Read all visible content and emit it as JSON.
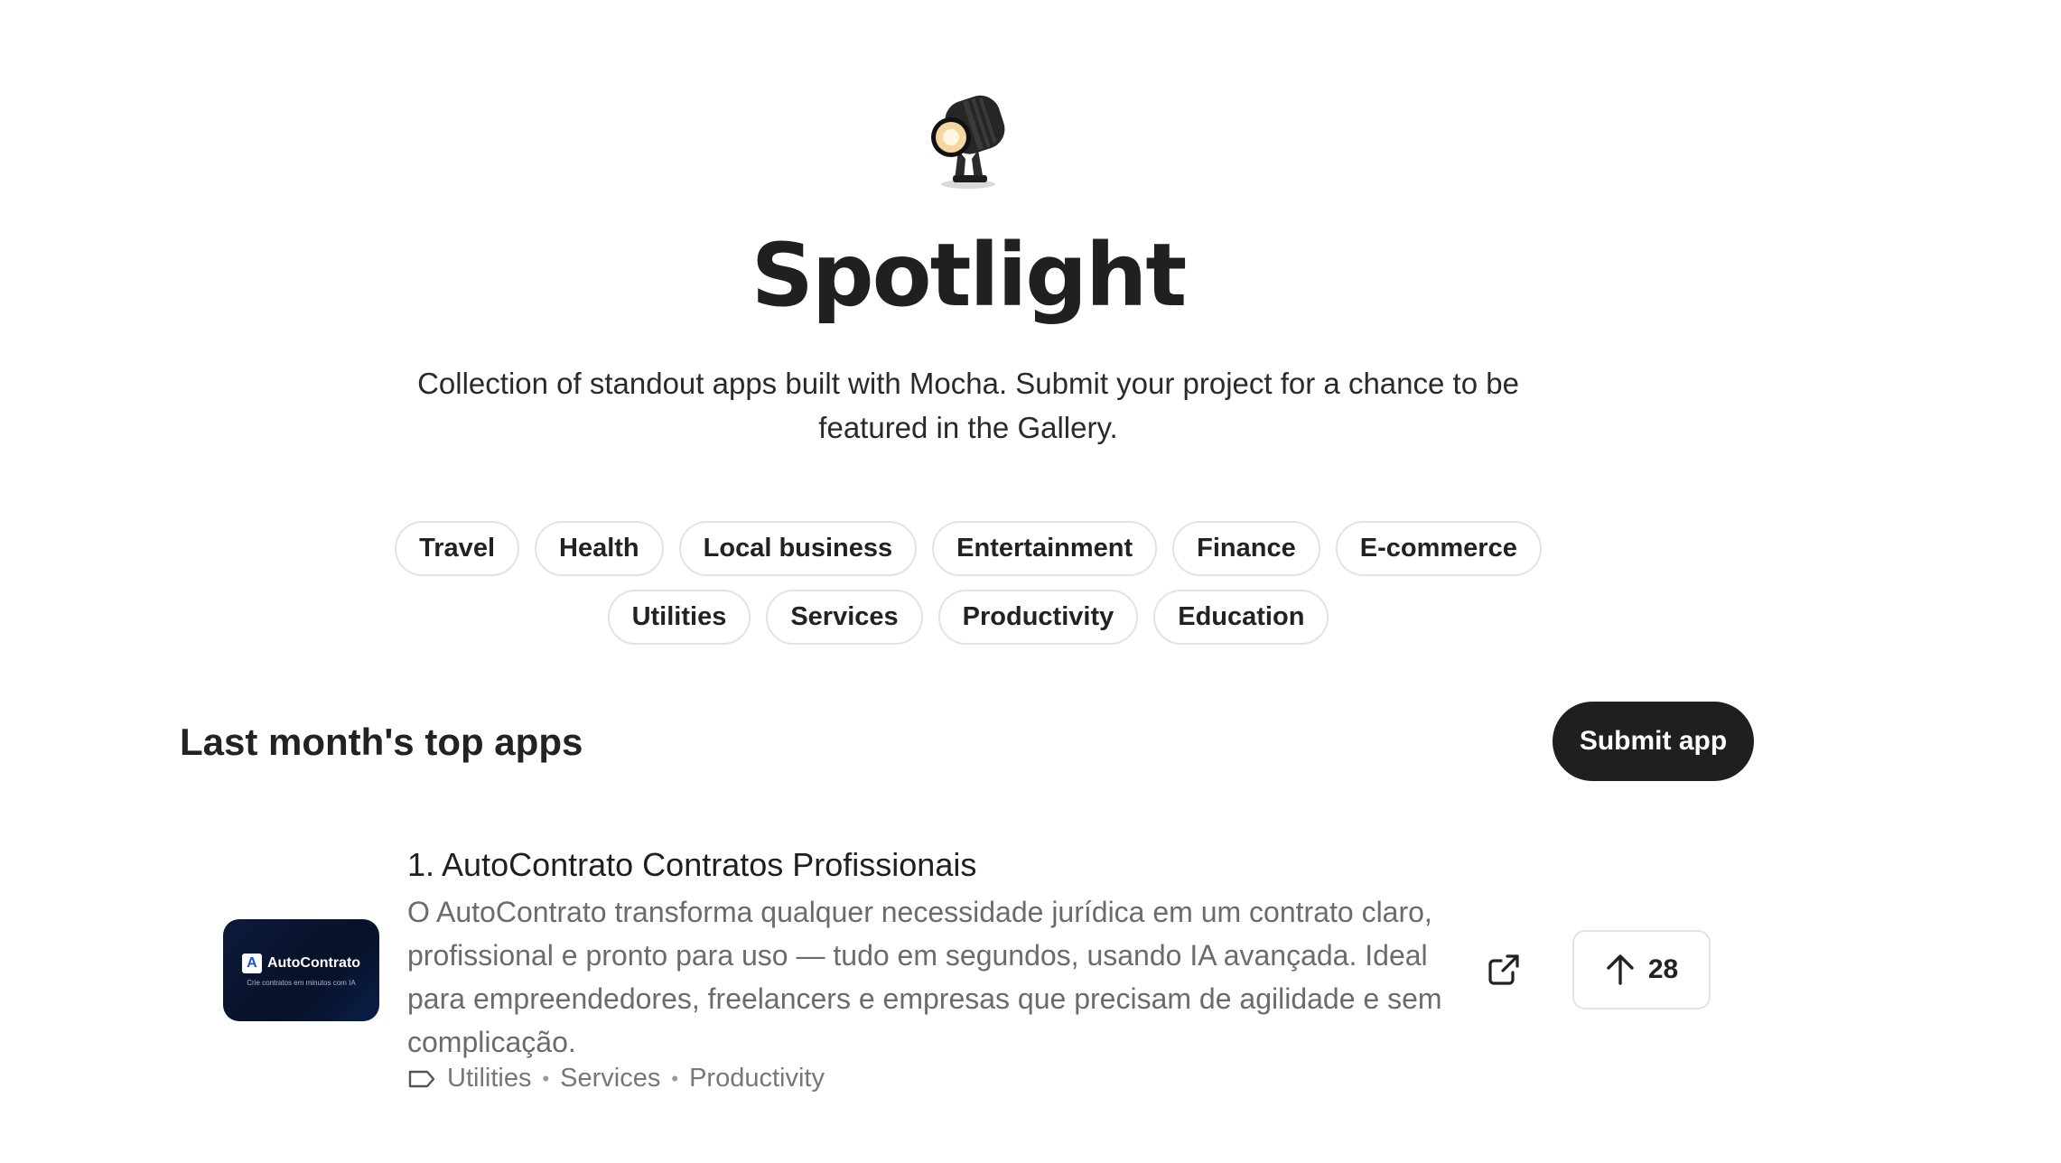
{
  "header": {
    "icon": "spotlight-lamp-icon",
    "title": "Spotlight",
    "subtitle": "Collection of standout apps built with Mocha. Submit your project for a chance to be featured in the Gallery."
  },
  "categories": {
    "row1": [
      "Travel",
      "Health",
      "Local business",
      "Entertainment",
      "Finance",
      "E-commerce"
    ],
    "row2": [
      "Utilities",
      "Services",
      "Productivity",
      "Education"
    ]
  },
  "section": {
    "title": "Last month's top apps",
    "submit_label": "Submit app"
  },
  "apps": [
    {
      "rank_title": "1. AutoContrato Contratos Profissionais",
      "description": "O AutoContrato transforma qualquer necessidade jurídica em um contrato claro, profissional e pronto para uso — tudo em segundos, usando IA avançada. Ideal para empreendedores, freelancers e empresas que precisam de agilidade e sem complicação.",
      "thumbnail": {
        "logo_letter": "A",
        "name": "AutoContrato",
        "tagline": "Crie contratos em minutos com IA"
      },
      "tags": [
        "Utilities",
        "Services",
        "Productivity"
      ],
      "tag_separator": "•",
      "upvotes": "28"
    }
  ],
  "colors": {
    "primary_button": "#1f1f1f",
    "chip_border": "#e3e3e3",
    "muted_text": "#6b6b6b"
  }
}
